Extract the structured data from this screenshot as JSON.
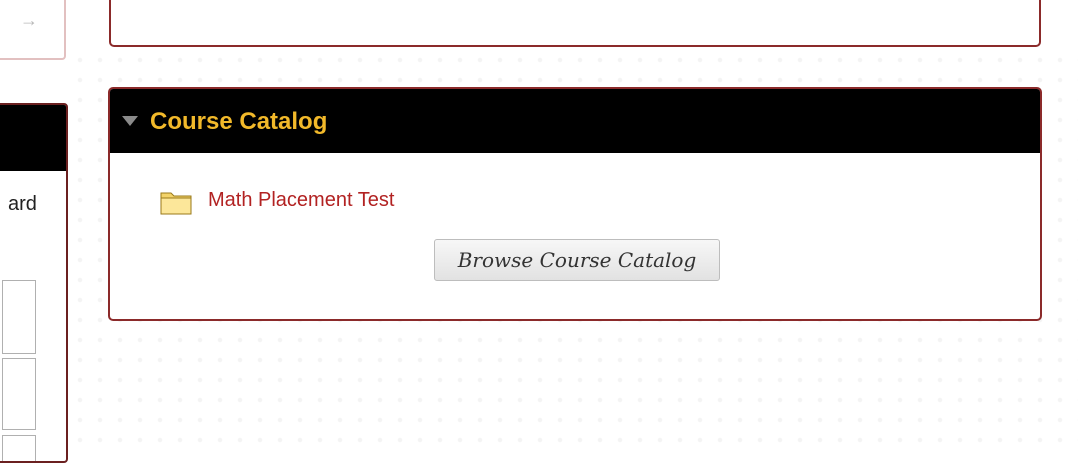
{
  "left_panel": {
    "partial_text": "ard"
  },
  "course_catalog": {
    "title": "Course Catalog",
    "items": [
      {
        "label": "Math Placement Test",
        "icon": "folder-icon"
      }
    ],
    "browse_label": "Browse Course Catalog"
  },
  "colors": {
    "panel_border": "#8b2a2a",
    "header_bg": "#000000",
    "title_color": "#f2b92a",
    "link_color": "#b22222"
  }
}
